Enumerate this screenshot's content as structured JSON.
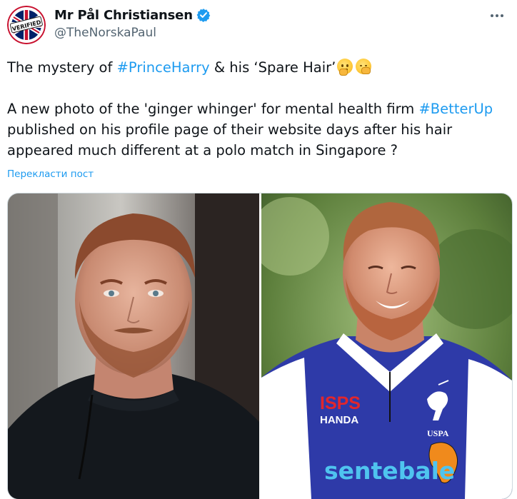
{
  "author": {
    "display_name": "Mr Pål Christiansen",
    "handle": "@TheNorskaPaul",
    "avatar_badge_text": "VERIFIED"
  },
  "tweet": {
    "line1_a": "The mystery of ",
    "line1_hashtag": "#PrinceHarry",
    "line1_b": " & his ‘Spare Hair’",
    "para2_a": "A new photo of the 'ginger whinger' for mental health firm ",
    "para2_hashtag": "#BetterUp",
    "para2_b": " published on his profile page of their website days after his hair appeared much different at a polo match in Singapore ?",
    "translate_label": "Перекласти пост"
  },
  "media": {
    "right_shirt_text_1": "ISPS",
    "right_shirt_text_2": "HANDA",
    "right_shirt_text_3": "USPA",
    "right_shirt_text_4": "sentebale"
  },
  "colors": {
    "link": "#1d9bf0",
    "verified": "#1d9bf0",
    "secondary_text": "#536471"
  },
  "icons": {
    "verified": "verified-badge-icon",
    "more": "more-horizontal-icon",
    "emoji_1": "thinking-face-emoji",
    "emoji_2": "hand-over-mouth-emoji"
  }
}
